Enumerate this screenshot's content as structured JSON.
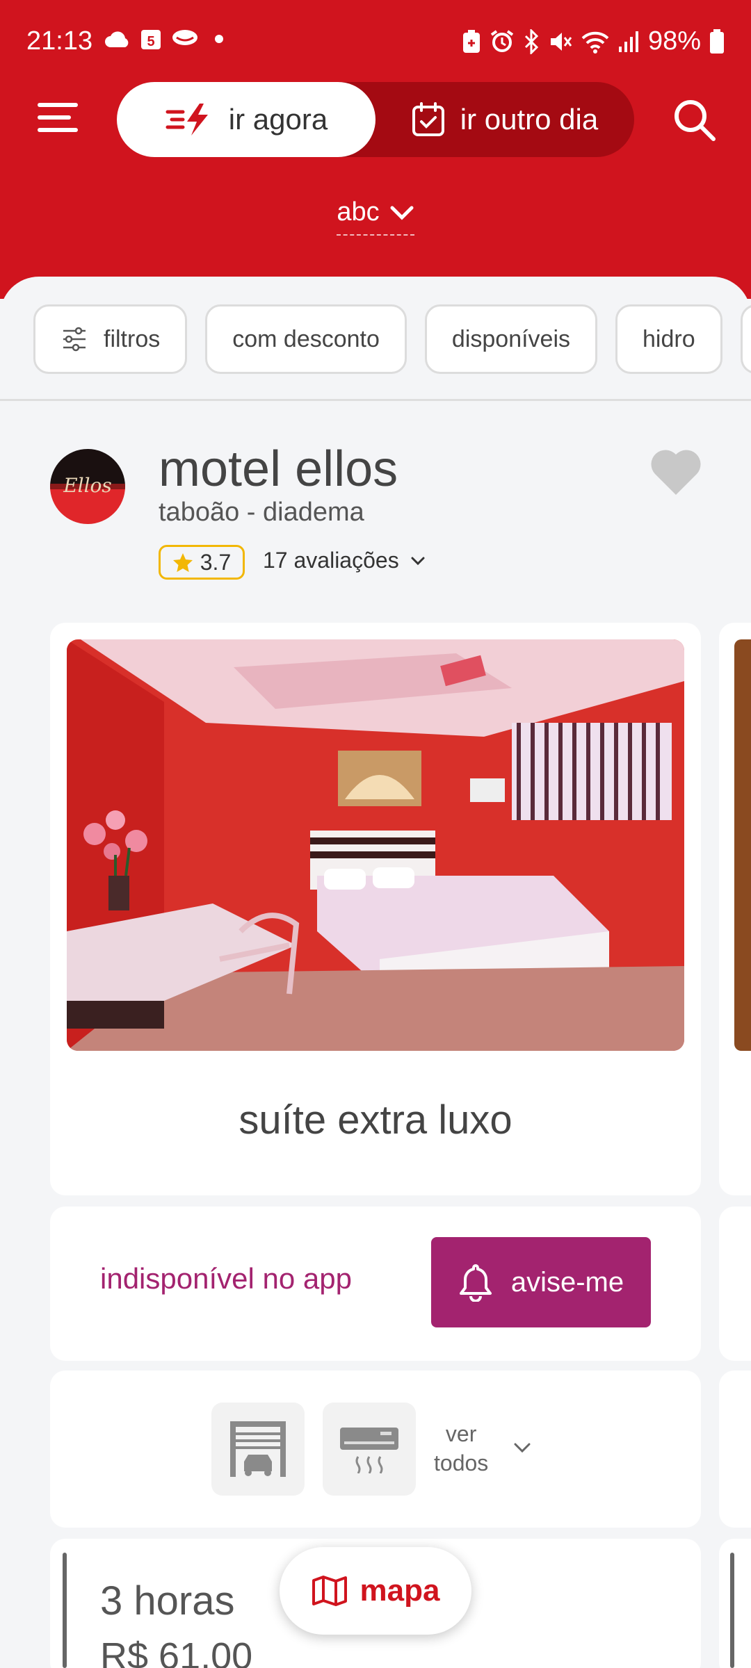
{
  "status_bar": {
    "time": "21:13",
    "battery": "98%",
    "left_icons": [
      "cloud-icon",
      "calendar-5-icon",
      "chat-app-icon",
      "dot-icon"
    ],
    "right_icons": [
      "battery-saver-icon",
      "alarm-icon",
      "bluetooth-icon",
      "mute-icon",
      "wifi-icon",
      "signal-icon",
      "battery-icon"
    ]
  },
  "header": {
    "toggle": {
      "now_label": "ir agora",
      "other_day_label": "ir outro dia"
    },
    "region": "abc",
    "accent_color": "#d0141e"
  },
  "filters": {
    "items": [
      "filtros",
      "com desconto",
      "disponíveis",
      "hidro"
    ]
  },
  "hotel": {
    "name": "motel ellos",
    "logo_text": "Ellos",
    "location": "taboão - diadema",
    "rating": "3.7",
    "reviews": "17 avaliações"
  },
  "suite": {
    "name": "suíte extra luxo",
    "availability": "indisponível no app",
    "notify_label": "avise-me",
    "notify_color": "#a3236f",
    "amenities": [
      "garage-icon",
      "air-conditioner-icon"
    ],
    "see_all": [
      "ver",
      "todos"
    ],
    "duration": "3 horas",
    "price": "R$ 61,00"
  },
  "map_button": {
    "label": "mapa"
  }
}
